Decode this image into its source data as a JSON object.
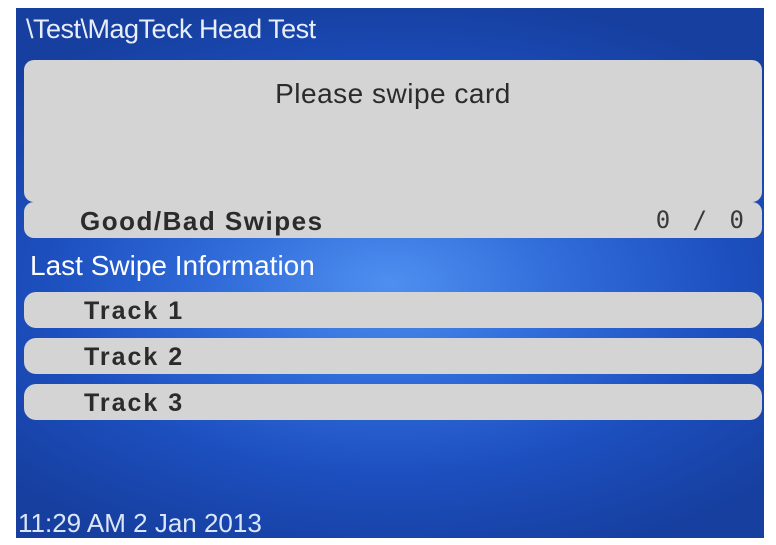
{
  "header": {
    "path_title": "\\Test\\MagTeck Head Test"
  },
  "message": {
    "prompt": "Please swipe card"
  },
  "swipes": {
    "label": "Good/Bad Swipes",
    "count": "0 / 0"
  },
  "last_swipe": {
    "heading": "Last Swipe Information",
    "tracks": [
      {
        "label": "Track 1"
      },
      {
        "label": "Track 2"
      },
      {
        "label": "Track 3"
      }
    ]
  },
  "status": {
    "datetime": "11:29 AM 2 Jan 2013"
  },
  "colors": {
    "background": "#2f6ad8",
    "panel": "#d4d4d4",
    "text_dark": "#2b2b2b",
    "text_light": "#ffffff"
  }
}
